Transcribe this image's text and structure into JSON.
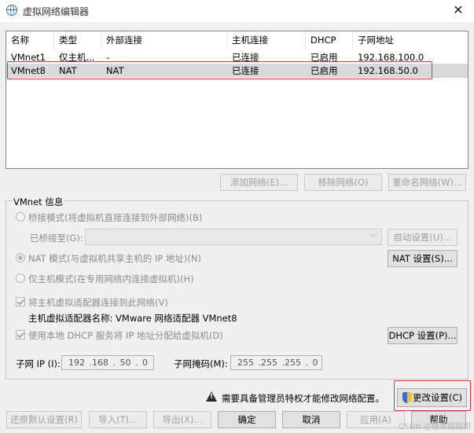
{
  "window": {
    "title": "虚拟网络编辑器",
    "close": "✕"
  },
  "list": {
    "headers": [
      "名称",
      "类型",
      "外部连接",
      "主机连接",
      "DHCP",
      "子网地址"
    ],
    "rows": [
      [
        "VMnet1",
        "仅主机...",
        "-",
        "已连接",
        "已启用",
        "192.168.100.0"
      ],
      [
        "VMnet8",
        "NAT",
        "NAT",
        "已连接",
        "已启用",
        "192.168.50.0"
      ]
    ],
    "selected_row": "VMnet8"
  },
  "list_buttons": {
    "add": "添加网络(E)...",
    "remove": "移除网络(O)",
    "rename": "重命名网络(W)..."
  },
  "info": {
    "group_label": "VMnet 信息",
    "bridge_mode": "桥接模式(将虚拟机直接连接到外部网络)(B)",
    "bridged_to": "已桥接至(G):",
    "bridged_value": "",
    "auto_settings": "自动设置(U)...",
    "nat_mode": "NAT 模式(与虚拟机共享主机的 IP 地址)(N)",
    "nat_settings": "NAT 设置(S)...",
    "host_only": "仅主机模式(在专用网络内连接虚拟机)(H)",
    "connect_adapter": "将主机虚拟适配器连接到此网络(V)",
    "adapter_name": "主机虚拟适配器名称: VMware 网络适配器 VMnet8",
    "use_dhcp": "使用本地 DHCP 服务将 IP 地址分配给虚拟机(D)",
    "dhcp_settings": "DHCP 设置(P)...",
    "subnet_ip_label": "子网 IP (I):",
    "subnet_ip": "192 .168 . 50 . 0",
    "subnet_mask_label": "子网掩码(M):",
    "subnet_mask": "255 .255 .255 . 0"
  },
  "admin_notice": "需要具备管理员特权才能修改网络配置。",
  "change_settings": "更改设置(C)",
  "footer": {
    "restore": "还原默认设置(R)",
    "import": "导入(T)...",
    "export": "导出(X)...",
    "ok": "确定",
    "cancel": "取消",
    "apply": "应用(A)",
    "help": "帮助"
  },
  "watermark": "CSDN @糖果甜甜甜"
}
